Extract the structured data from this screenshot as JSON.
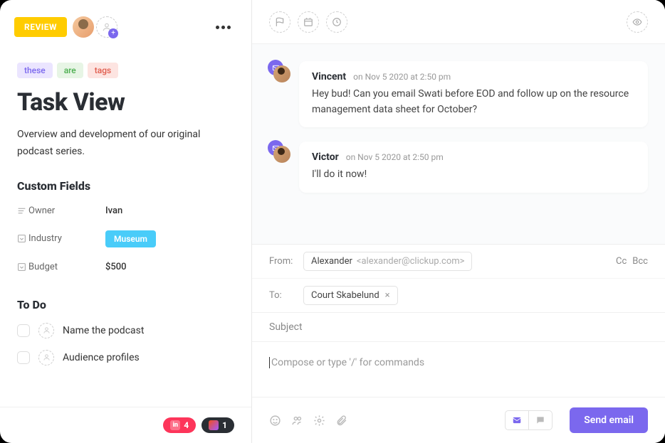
{
  "header": {
    "status": "REVIEW"
  },
  "tags": [
    "these",
    "are",
    "tags"
  ],
  "task": {
    "title": "Task View",
    "description": "Overview and development of our original podcast series."
  },
  "custom_fields": {
    "heading": "Custom Fields",
    "rows": [
      {
        "label": "Owner",
        "value": "Ivan"
      },
      {
        "label": "Industry",
        "value": "Museum"
      },
      {
        "label": "Budget",
        "value": "$500"
      }
    ]
  },
  "todo": {
    "heading": "To Do",
    "items": [
      {
        "text": "Name the podcast"
      },
      {
        "text": "Audience profiles"
      }
    ]
  },
  "footer_chips": {
    "invision": "4",
    "figma": "1"
  },
  "thread": [
    {
      "name": "Vincent",
      "time": "on Nov 5 2020 at 2:50 pm",
      "body": "Hey bud! Can you email Swati before EOD and follow up on the resource management data sheet for October?"
    },
    {
      "name": "Victor",
      "time": "on Nov 5 2020 at 2:50 pm",
      "body": "I'll do it now!"
    }
  ],
  "compose": {
    "from_label": "From:",
    "from_name": "Alexander",
    "from_email": "<alexander@clickup.com>",
    "to_label": "To:",
    "to_chip": "Court Skabelund",
    "cc": "Cc",
    "bcc": "Bcc",
    "subject_placeholder": "Subject",
    "body_placeholder": "Compose or type '/' for commands",
    "send": "Send email"
  }
}
